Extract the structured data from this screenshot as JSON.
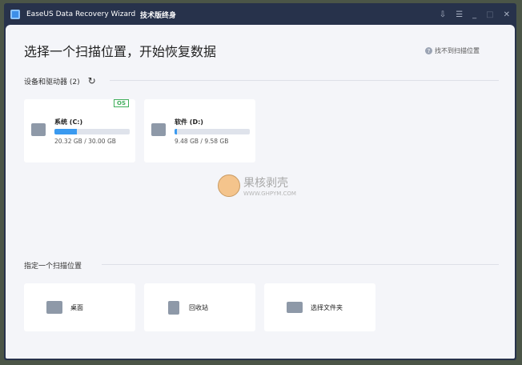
{
  "window": {
    "title": "EaseUS Data Recovery Wizard",
    "edition": "技术版终身"
  },
  "header": {
    "title": "选择一个扫描位置，开始恢复数据",
    "help": "找不到扫描位置"
  },
  "devices": {
    "label": "设备和驱动器 (2)",
    "drives": [
      {
        "name": "系统 (C:)",
        "size": "20.32 GB / 30.00 GB",
        "badge": "OS",
        "fill_percent": 30
      },
      {
        "name": "软件 (D:)",
        "size": "9.48 GB / 9.58 GB",
        "fill_percent": 3
      }
    ]
  },
  "locations": {
    "label": "指定一个扫描位置",
    "items": [
      {
        "label": "桌面"
      },
      {
        "label": "回收站"
      },
      {
        "label": "选择文件夹"
      }
    ]
  },
  "watermark": {
    "text": "果核剥壳",
    "url": "WWW.GHPYM.COM"
  }
}
